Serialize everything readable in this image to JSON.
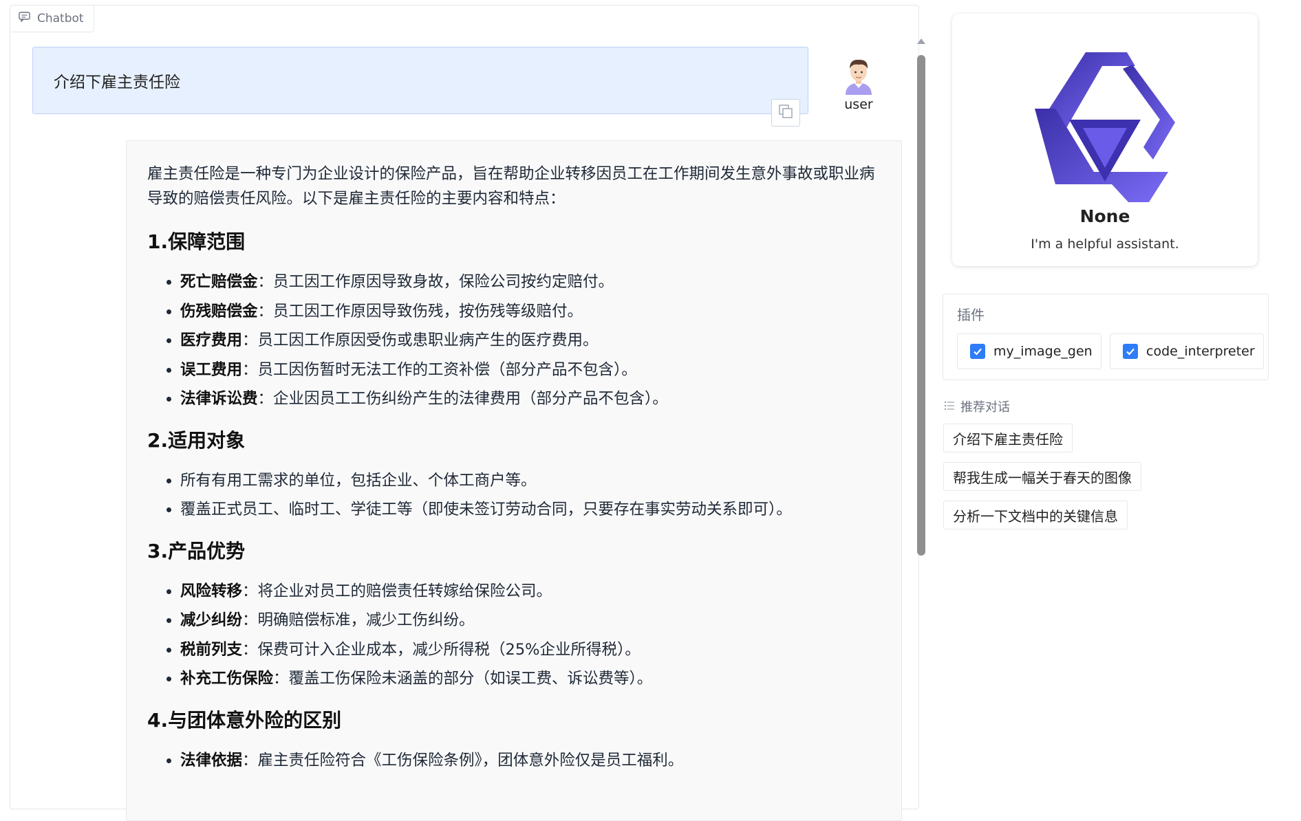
{
  "chatbot": {
    "label": "Chatbot",
    "user_message": "介绍下雇主责任险",
    "user_name": "user",
    "response": {
      "intro": "雇主责任险是一种专门为企业设计的保险产品，旨在帮助企业转移因员工在工作期间发生意外事故或职业病导致的赔偿责任风险。以下是雇主责任险的主要内容和特点：",
      "sections": [
        {
          "heading": "1.保障范围",
          "items": [
            {
              "bold": "死亡赔偿金",
              "text": "：员工因工作原因导致身故，保险公司按约定赔付。"
            },
            {
              "bold": "伤残赔偿金",
              "text": "：员工因工作原因导致伤残，按伤残等级赔付。"
            },
            {
              "bold": "医疗费用",
              "text": "：员工因工作原因受伤或患职业病产生的医疗费用。"
            },
            {
              "bold": "误工费用",
              "text": "：员工因伤暂时无法工作的工资补偿（部分产品不包含）。"
            },
            {
              "bold": "法律诉讼费",
              "text": "：企业因员工工伤纠纷产生的法律费用（部分产品不包含）。"
            }
          ]
        },
        {
          "heading": "2.适用对象",
          "items": [
            {
              "bold": "",
              "text": "所有有用工需求的单位，包括企业、个体工商户等。"
            },
            {
              "bold": "",
              "text": "覆盖正式员工、临时工、学徒工等（即使未签订劳动合同，只要存在事实劳动关系即可）。"
            }
          ]
        },
        {
          "heading": "3.产品优势",
          "items": [
            {
              "bold": "风险转移",
              "text": "：将企业对员工的赔偿责任转嫁给保险公司。"
            },
            {
              "bold": "减少纠纷",
              "text": "：明确赔偿标准，减少工伤纠纷。"
            },
            {
              "bold": "税前列支",
              "text": "：保费可计入企业成本，减少所得税（25%企业所得税）。"
            },
            {
              "bold": "补充工伤保险",
              "text": "：覆盖工伤保险未涵盖的部分（如误工费、诉讼费等）。"
            }
          ]
        },
        {
          "heading": "4.与团体意外险的区别",
          "items": [
            {
              "bold": "法律依据",
              "text": "：雇主责任险符合《工伤保险条例》，团体意外险仅是员工福利。"
            }
          ]
        }
      ]
    }
  },
  "profile": {
    "name": "None",
    "description": "I'm a helpful assistant."
  },
  "plugins": {
    "title": "插件",
    "items": [
      {
        "name": "my_image_gen",
        "checked": true
      },
      {
        "name": "code_interpreter",
        "checked": true
      }
    ]
  },
  "recommendations": {
    "title": "推荐对话",
    "items": [
      "介绍下雇主责任险",
      "帮我生成一幅关于春天的图像",
      "分析一下文档中的关键信息"
    ]
  },
  "colors": {
    "accent": "#2e7cf6",
    "user_bubble": "#e7f0fe",
    "logo_dark": "#3b2fa8",
    "logo_light": "#7b6cf6"
  }
}
